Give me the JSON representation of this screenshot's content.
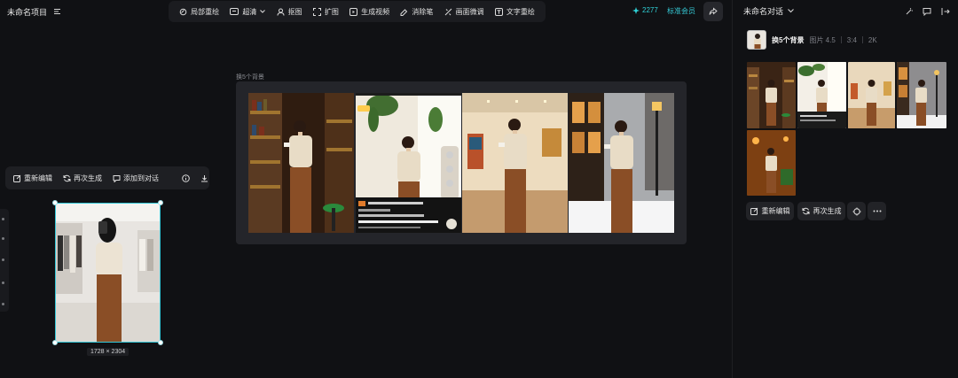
{
  "project": {
    "title": "未命名项目",
    "menu_icon": "menu-lines-icon"
  },
  "toolbar": {
    "items": [
      {
        "label": "局部重绘",
        "icon": "brush-icon"
      },
      {
        "label": "超清",
        "icon": "hd-icon"
      },
      {
        "label": "抠图",
        "icon": "cutout-icon"
      },
      {
        "label": "扩图",
        "icon": "expand-icon"
      },
      {
        "label": "生成视频",
        "icon": "video-icon"
      },
      {
        "label": "消除笔",
        "icon": "eraser-icon"
      },
      {
        "label": "画面微调",
        "icon": "adjust-icon"
      },
      {
        "label": "文字重绘",
        "icon": "text-icon"
      }
    ]
  },
  "account": {
    "credits": "2277",
    "membership": "标准会员",
    "share_icon": "share-icon"
  },
  "chat": {
    "title": "未命名对话",
    "message": {
      "title": "换5个背景",
      "type": "图片 4.5",
      "ratio": "3:4",
      "resolution": "2K"
    },
    "actions": {
      "re_edit": "重新编辑",
      "regenerate": "再次生成"
    }
  },
  "canvas": {
    "preview_label": "换5个背景",
    "image_bar": {
      "re_edit": "重新编辑",
      "regenerate": "再次生成",
      "add_to_chat": "添加到对话"
    },
    "selected_size": "1728 × 2304"
  },
  "colors": {
    "accent": "#34c6d6",
    "background": "#101114",
    "panel": "#1b1c20",
    "sweater": "#e8dcc6",
    "trousers": "#8a4e26"
  }
}
